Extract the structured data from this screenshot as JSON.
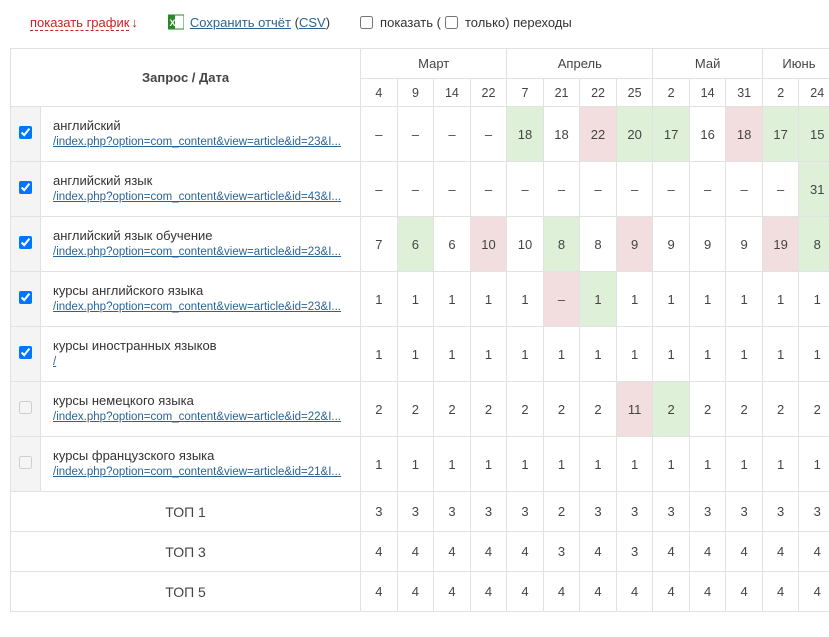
{
  "toolbar": {
    "show_chart": "показать график",
    "arrow": "↓",
    "save_report": "Сохранить отчёт",
    "csv": "CSV",
    "show_label": "показать (",
    "only_label": " только) переходы"
  },
  "header": {
    "query_date": "Запрос / Дата",
    "months": [
      {
        "name": "Март",
        "days": [
          "4",
          "9",
          "14",
          "22"
        ]
      },
      {
        "name": "Апрель",
        "days": [
          "7",
          "21",
          "22",
          "25"
        ]
      },
      {
        "name": "Май",
        "days": [
          "2",
          "14",
          "31"
        ]
      },
      {
        "name": "Июнь",
        "days": [
          "2",
          "24"
        ]
      }
    ]
  },
  "rows": [
    {
      "checked": true,
      "enabled": true,
      "title": "английский",
      "url": "/index.php?option=com_content&view=article&id=23&I...",
      "cells": [
        {
          "v": "–"
        },
        {
          "v": "–"
        },
        {
          "v": "–"
        },
        {
          "v": "–"
        },
        {
          "v": "18",
          "c": "green"
        },
        {
          "v": "18"
        },
        {
          "v": "22",
          "c": "red"
        },
        {
          "v": "20",
          "c": "green"
        },
        {
          "v": "17",
          "c": "green"
        },
        {
          "v": "16"
        },
        {
          "v": "18",
          "c": "red"
        },
        {
          "v": "17",
          "c": "green"
        },
        {
          "v": "15",
          "c": "green"
        }
      ]
    },
    {
      "checked": true,
      "enabled": true,
      "title": "английский язык",
      "url": "/index.php?option=com_content&view=article&id=43&I...",
      "cells": [
        {
          "v": "–"
        },
        {
          "v": "–"
        },
        {
          "v": "–"
        },
        {
          "v": "–"
        },
        {
          "v": "–"
        },
        {
          "v": "–"
        },
        {
          "v": "–"
        },
        {
          "v": "–"
        },
        {
          "v": "–"
        },
        {
          "v": "–"
        },
        {
          "v": "–"
        },
        {
          "v": "–"
        },
        {
          "v": "31",
          "c": "green"
        }
      ]
    },
    {
      "checked": true,
      "enabled": true,
      "title": "английский язык обучение",
      "url": "/index.php?option=com_content&view=article&id=23&I...",
      "cells": [
        {
          "v": "7"
        },
        {
          "v": "6",
          "c": "green"
        },
        {
          "v": "6"
        },
        {
          "v": "10",
          "c": "red"
        },
        {
          "v": "10"
        },
        {
          "v": "8",
          "c": "green"
        },
        {
          "v": "8"
        },
        {
          "v": "9",
          "c": "red"
        },
        {
          "v": "9"
        },
        {
          "v": "9"
        },
        {
          "v": "9"
        },
        {
          "v": "19",
          "c": "red"
        },
        {
          "v": "8",
          "c": "green"
        }
      ]
    },
    {
      "checked": true,
      "enabled": true,
      "title": "курсы английского языка",
      "url": "/index.php?option=com_content&view=article&id=23&I...",
      "cells": [
        {
          "v": "1"
        },
        {
          "v": "1"
        },
        {
          "v": "1"
        },
        {
          "v": "1"
        },
        {
          "v": "1"
        },
        {
          "v": "–",
          "c": "red"
        },
        {
          "v": "1",
          "c": "green"
        },
        {
          "v": "1"
        },
        {
          "v": "1"
        },
        {
          "v": "1"
        },
        {
          "v": "1"
        },
        {
          "v": "1"
        },
        {
          "v": "1"
        }
      ]
    },
    {
      "checked": true,
      "enabled": true,
      "title": "курсы иностранных языков",
      "url": "/",
      "cells": [
        {
          "v": "1"
        },
        {
          "v": "1"
        },
        {
          "v": "1"
        },
        {
          "v": "1"
        },
        {
          "v": "1"
        },
        {
          "v": "1"
        },
        {
          "v": "1"
        },
        {
          "v": "1"
        },
        {
          "v": "1"
        },
        {
          "v": "1"
        },
        {
          "v": "1"
        },
        {
          "v": "1"
        },
        {
          "v": "1"
        }
      ]
    },
    {
      "checked": false,
      "enabled": false,
      "title": "курсы немецкого языка",
      "url": "/index.php?option=com_content&view=article&id=22&I...",
      "cells": [
        {
          "v": "2"
        },
        {
          "v": "2"
        },
        {
          "v": "2"
        },
        {
          "v": "2"
        },
        {
          "v": "2"
        },
        {
          "v": "2"
        },
        {
          "v": "2"
        },
        {
          "v": "11",
          "c": "red"
        },
        {
          "v": "2",
          "c": "green"
        },
        {
          "v": "2"
        },
        {
          "v": "2"
        },
        {
          "v": "2"
        },
        {
          "v": "2"
        }
      ]
    },
    {
      "checked": false,
      "enabled": false,
      "title": "курсы французского языка",
      "url": "/index.php?option=com_content&view=article&id=21&I...",
      "cells": [
        {
          "v": "1"
        },
        {
          "v": "1"
        },
        {
          "v": "1"
        },
        {
          "v": "1"
        },
        {
          "v": "1"
        },
        {
          "v": "1"
        },
        {
          "v": "1"
        },
        {
          "v": "1"
        },
        {
          "v": "1"
        },
        {
          "v": "1"
        },
        {
          "v": "1"
        },
        {
          "v": "1"
        },
        {
          "v": "1"
        }
      ]
    }
  ],
  "summary": [
    {
      "label": "ТОП 1",
      "cells": [
        "3",
        "3",
        "3",
        "3",
        "3",
        "2",
        "3",
        "3",
        "3",
        "3",
        "3",
        "3",
        "3"
      ]
    },
    {
      "label": "ТОП 3",
      "cells": [
        "4",
        "4",
        "4",
        "4",
        "4",
        "3",
        "4",
        "3",
        "4",
        "4",
        "4",
        "4",
        "4"
      ]
    },
    {
      "label": "ТОП 5",
      "cells": [
        "4",
        "4",
        "4",
        "4",
        "4",
        "4",
        "4",
        "4",
        "4",
        "4",
        "4",
        "4",
        "4"
      ]
    }
  ]
}
